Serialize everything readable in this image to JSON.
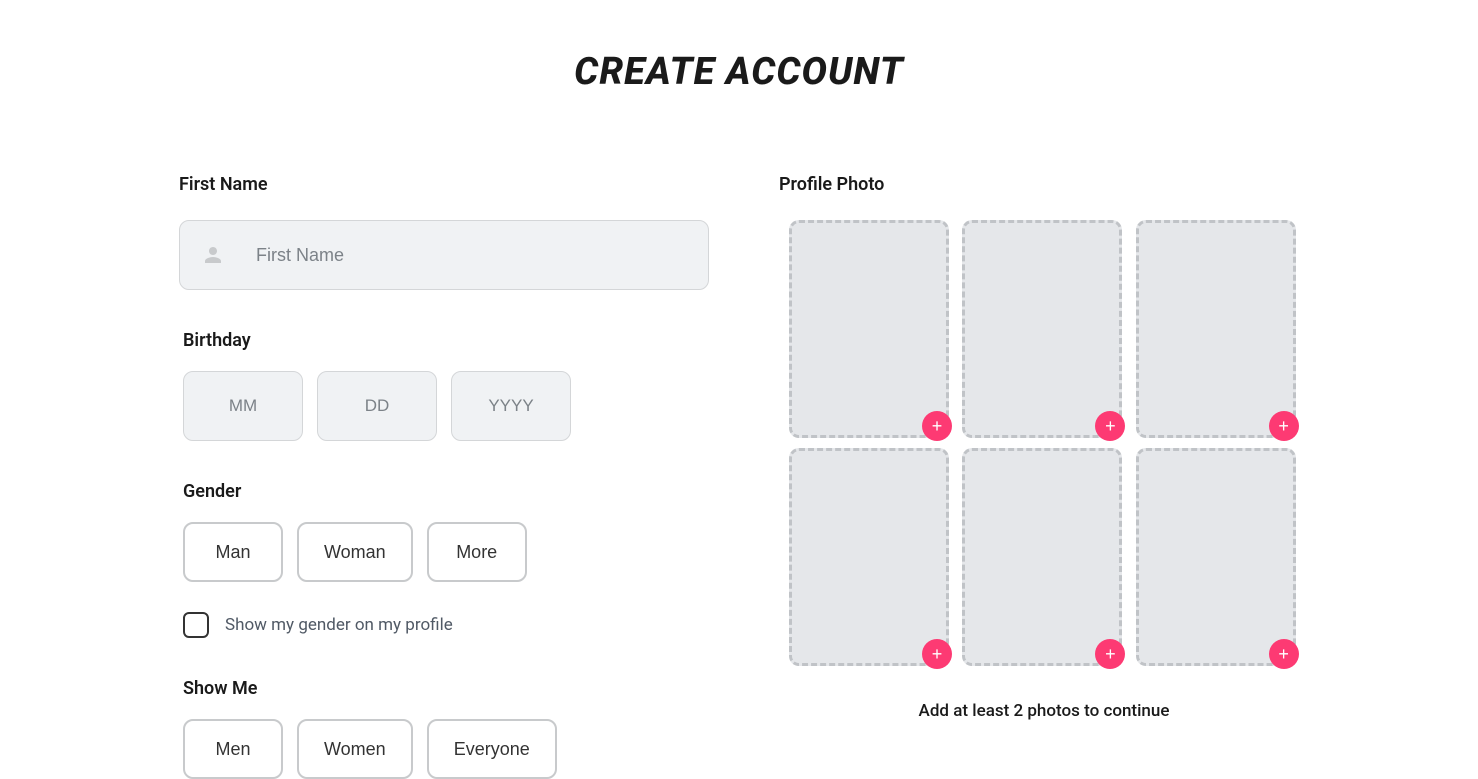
{
  "title": "CREATE ACCOUNT",
  "firstName": {
    "label": "First Name",
    "placeholder": "First Name"
  },
  "birthday": {
    "label": "Birthday",
    "month_placeholder": "MM",
    "day_placeholder": "DD",
    "year_placeholder": "YYYY"
  },
  "gender": {
    "label": "Gender",
    "options": {
      "man": "Man",
      "woman": "Woman",
      "more": "More"
    },
    "checkbox_label": "Show my gender on my profile"
  },
  "showMe": {
    "label": "Show Me",
    "options": {
      "men": "Men",
      "women": "Women",
      "everyone": "Everyone"
    }
  },
  "profilePhoto": {
    "label": "Profile Photo",
    "hint": "Add at least 2 photos to continue"
  }
}
